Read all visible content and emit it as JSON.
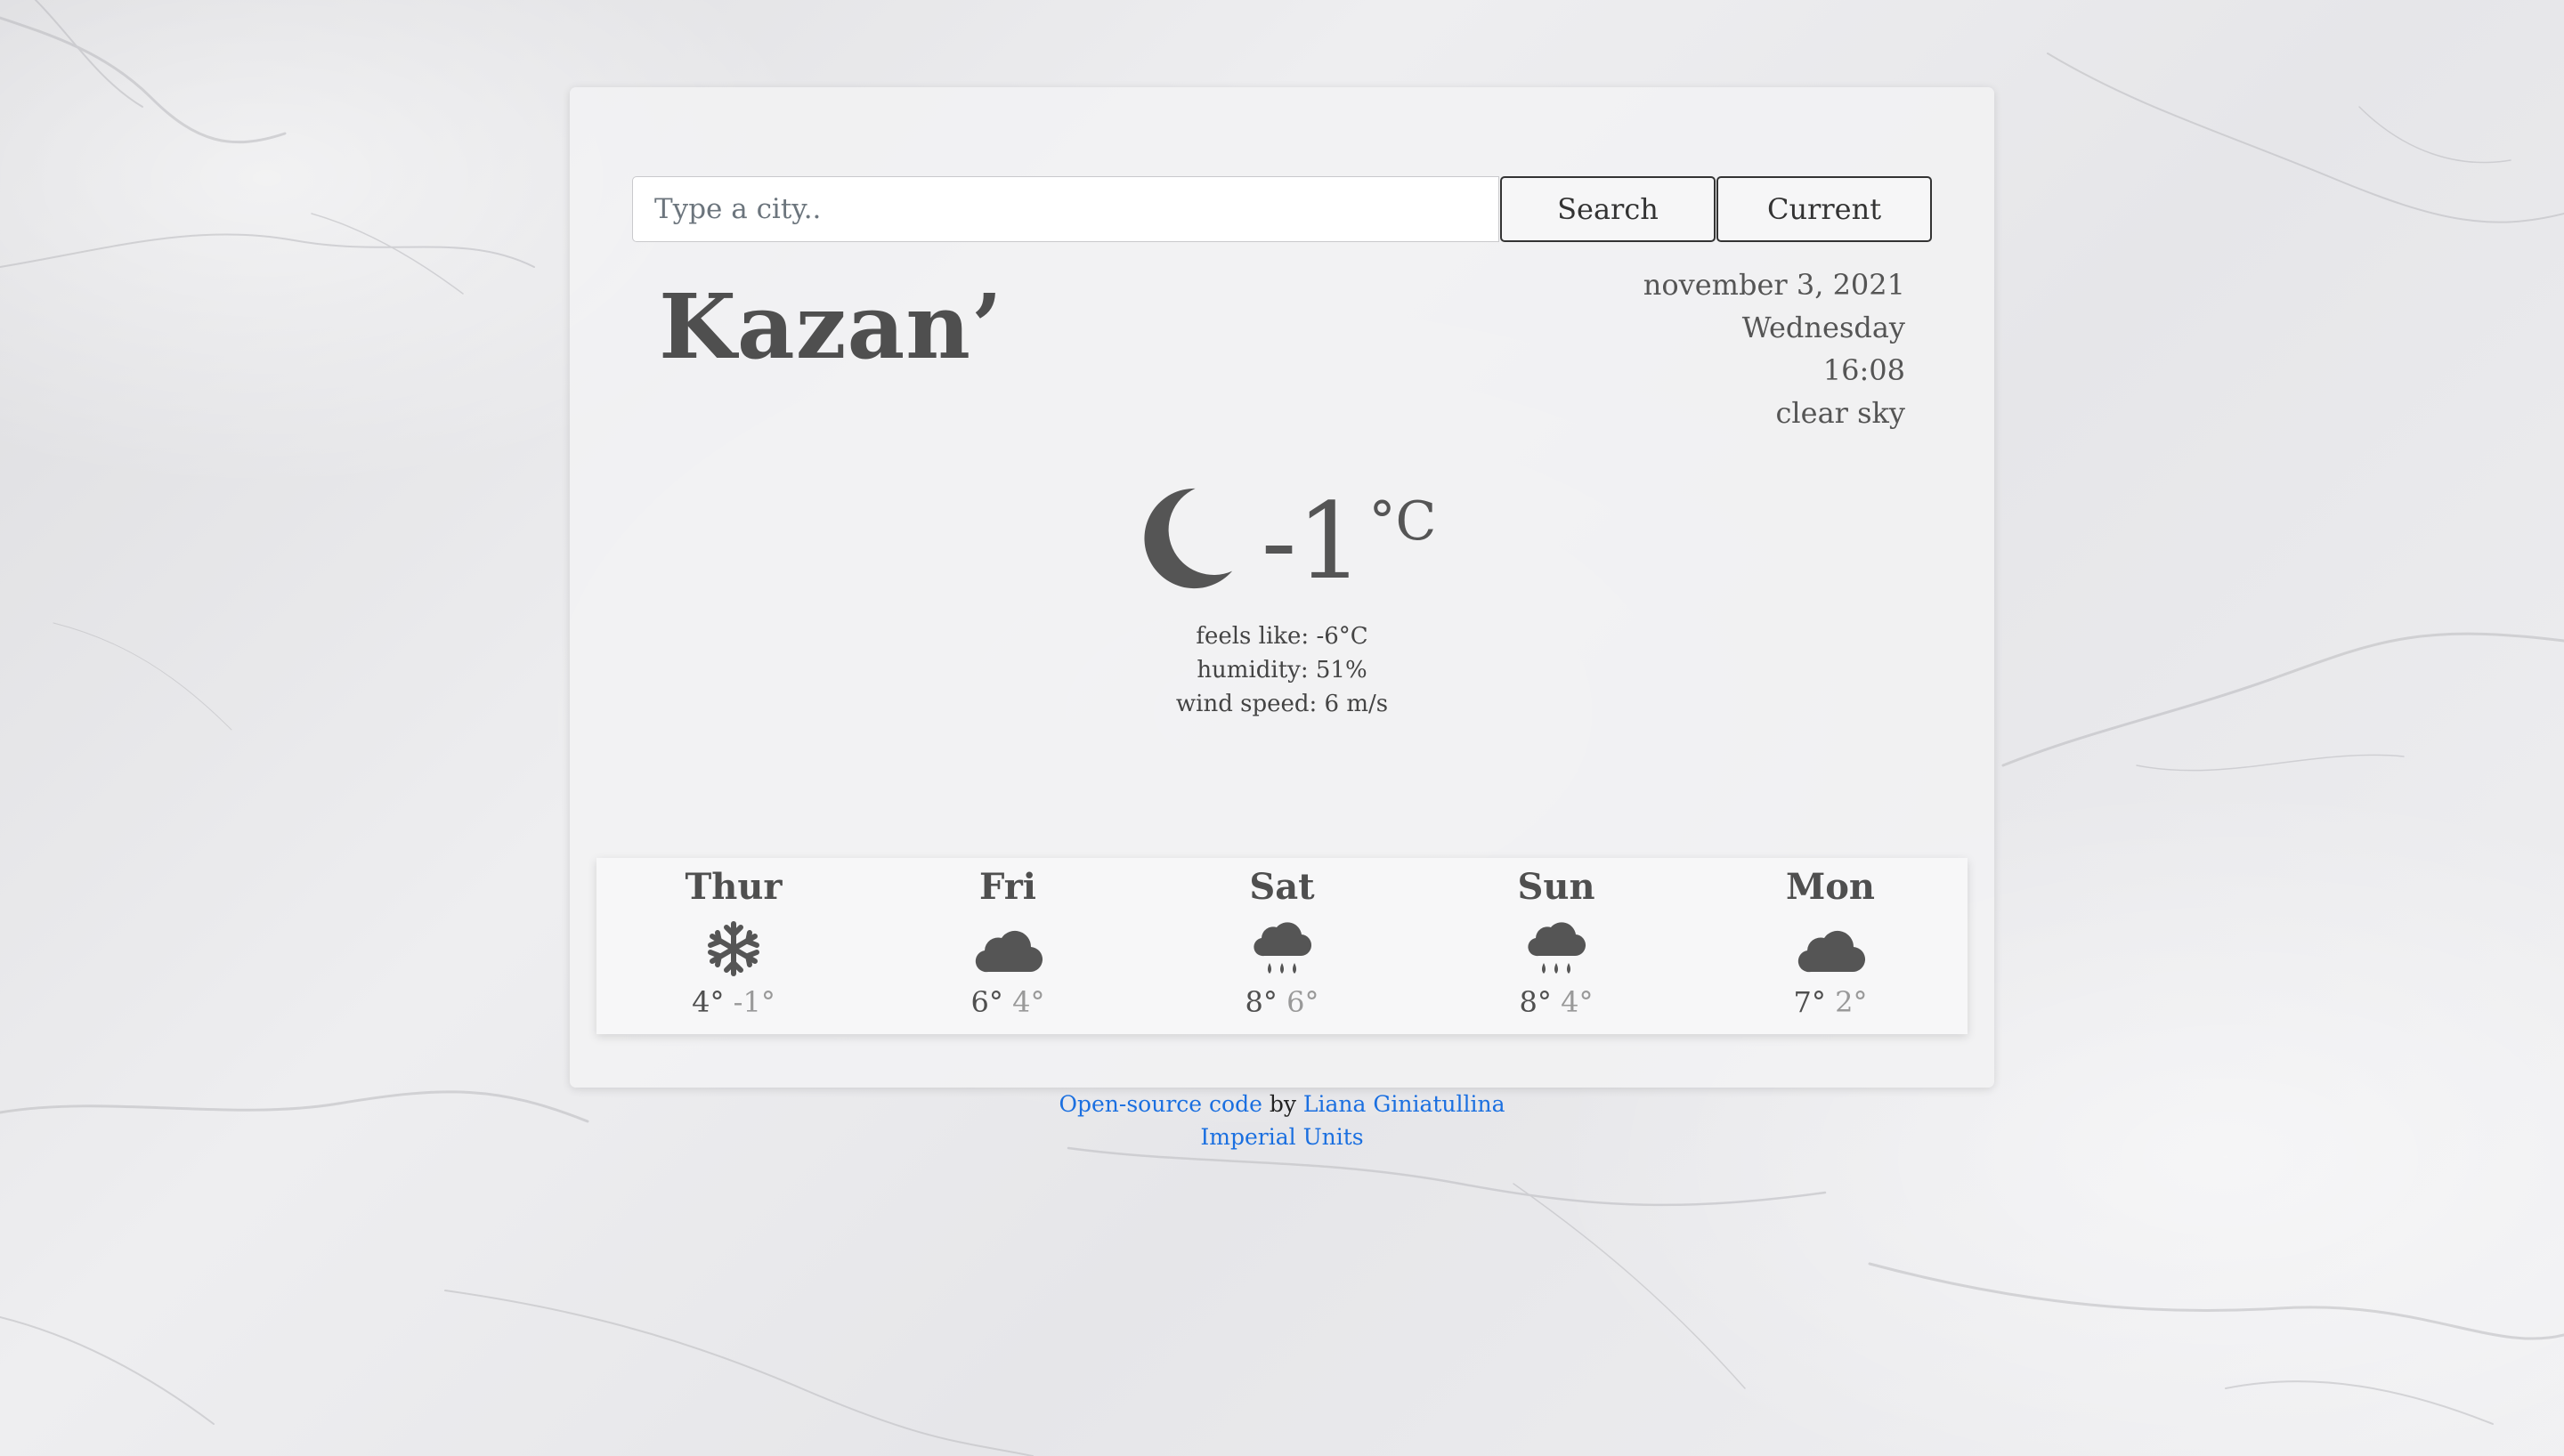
{
  "search": {
    "placeholder": "Type a city..",
    "search_label": "Search",
    "current_label": "Current"
  },
  "city": "Kazan’",
  "details": {
    "date": "november 3, 2021",
    "weekday": "Wednesday",
    "time": "16:08",
    "description": "clear sky"
  },
  "current": {
    "icon": "moon-icon",
    "temperature": "-1",
    "unit": "°C",
    "feels_like": "feels like: -6°C",
    "humidity": "humidity: 51%",
    "wind": "wind speed: 6 m/s"
  },
  "forecast": [
    {
      "day": "Thur",
      "icon": "snowflake-icon",
      "max": "4°",
      "min": "-1°"
    },
    {
      "day": "Fri",
      "icon": "cloud-icon",
      "max": "6°",
      "min": "4°"
    },
    {
      "day": "Sat",
      "icon": "cloud-rain-icon",
      "max": "8°",
      "min": "6°"
    },
    {
      "day": "Sun",
      "icon": "cloud-rain-icon",
      "max": "8°",
      "min": "4°"
    },
    {
      "day": "Mon",
      "icon": "cloud-icon",
      "max": "7°",
      "min": "2°"
    }
  ],
  "footer": {
    "source_link": "Open-source code",
    "by": "by",
    "author_link": "Liana Giniatullina",
    "units_link": "Imperial Units"
  },
  "colors": {
    "text": "#555555",
    "link": "#1a6fe0",
    "min_temp": "#999999"
  }
}
